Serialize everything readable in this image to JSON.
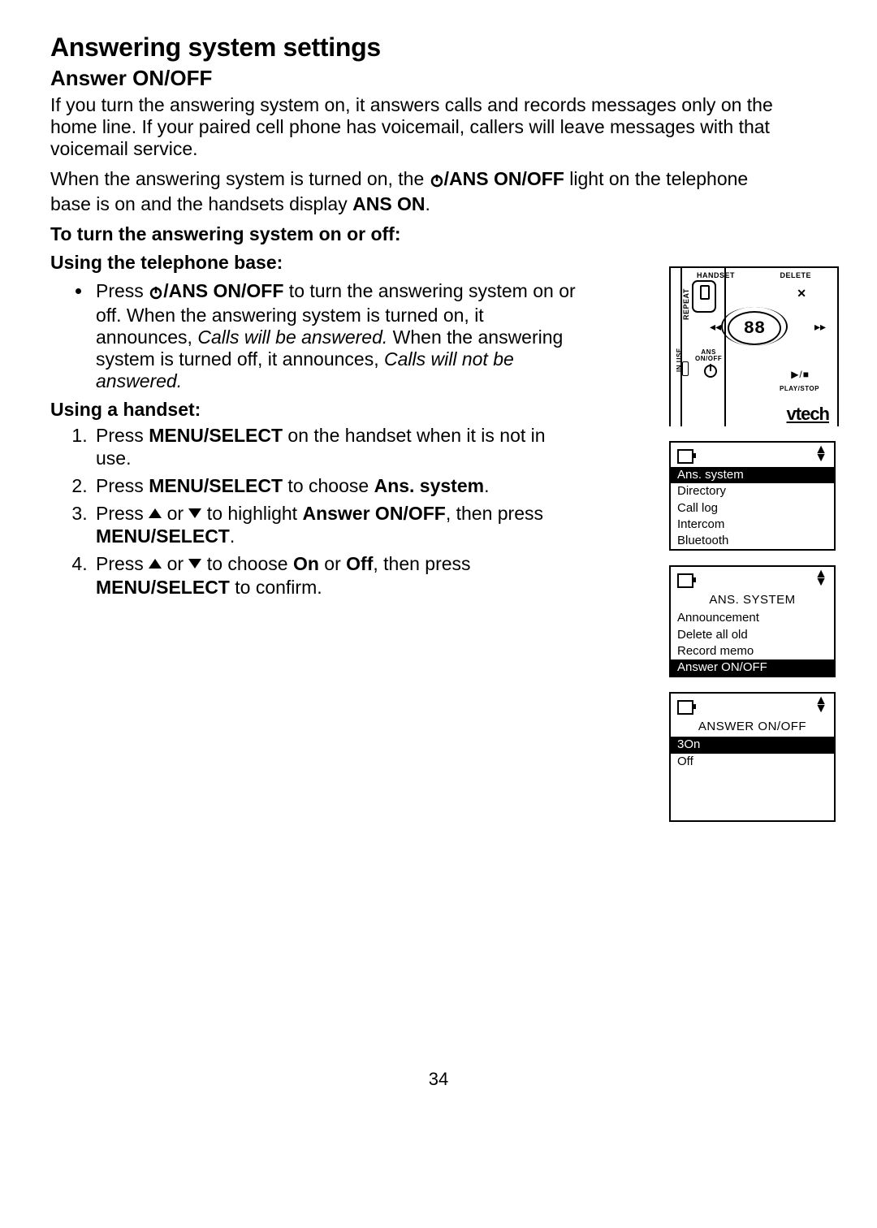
{
  "h1": "Answering system settings",
  "h2": "Answer ON/OFF",
  "p1": "If you turn the answering system on, it answers calls and records messages only on the home line. If your paired cell phone has voicemail, callers will leave messages with that voicemail service.",
  "p2a": "When the answering system is turned on, the ",
  "p2b": "/ANS ON/OFF",
  "p2c": " light on the telephone base is on and the handsets display ",
  "p2d": "ANS ON",
  "sub1": "To turn the answering system on or off:",
  "sub2": "Using the telephone base:",
  "bullet": {
    "a": "Press ",
    "b": "/ANS ON/OFF",
    "c": " to turn the answering system on or off. When the answering system is turned on, it announces,  ",
    "d": "Calls will be answered.",
    "e": "   When the answering system is turned off, it announces,  ",
    "f": "Calls will not be answered."
  },
  "sub3": "Using a handset:",
  "steps": {
    "s1a": "Press ",
    "s1b": "MENU/",
    "s1c": "SELECT",
    "s1d": " on the handset when it is not in use.",
    "s2a": "Press ",
    "s2b": "MENU",
    "s2c": "/SELECT",
    "s2d": " to choose ",
    "s2e": "Ans. system",
    "s3a": "Press ",
    "s3b": " or ",
    "s3c": " to highlight ",
    "s3d": "Answer ON/OFF",
    "s3e": ", then press ",
    "s3f": "MENU",
    "s3g": "/SELECT",
    "s4a": "Press ",
    "s4b": " or ",
    "s4c": " to choose ",
    "s4d": "On",
    "s4e": " or ",
    "s4f": "Off",
    "s4g": ", then press ",
    "s4h": "MENU",
    "s4i": "/SELECT",
    "s4j": " to confirm."
  },
  "base": {
    "handset": "HANDSET",
    "delete": "DELETE",
    "display": "88",
    "repeat": "REPEAT",
    "ans": "ANS",
    "onoff": "ON/OFF",
    "inuse": "IN USE",
    "playstop_lbl": "PLAY/STOP",
    "brand": "vtech"
  },
  "screens": {
    "s1": {
      "rows": [
        "Ans. system",
        "Directory",
        "Call log",
        "Intercom",
        "Bluetooth"
      ],
      "hi": 0
    },
    "s2": {
      "title": "ANS. SYSTEM",
      "rows": [
        "Announcement",
        "Delete all old",
        "Record memo",
        "Answer ON/OFF"
      ],
      "hi": 3
    },
    "s3": {
      "title": "ANSWER ON/OFF",
      "rows": [
        "3On",
        "Off"
      ],
      "hi": 0
    }
  },
  "page_number": "34"
}
